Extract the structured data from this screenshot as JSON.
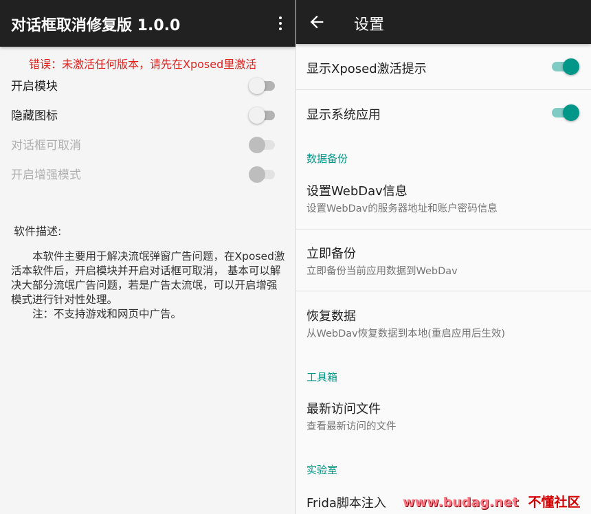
{
  "left": {
    "title": "对话框取消修复版 1.0.0",
    "error": "错误：未激活任何版本，请先在Xposed里激活",
    "switches": [
      {
        "label": "开启模块",
        "state": "off",
        "enabled": true
      },
      {
        "label": "隐藏图标",
        "state": "off",
        "enabled": true
      },
      {
        "label": "对话框可取消",
        "state": "off",
        "enabled": false
      },
      {
        "label": "开启增强模式",
        "state": "off",
        "enabled": false
      }
    ],
    "description_heading": "软件描述:",
    "description": [
      "本软件主要用于解决流氓弹窗广告问题，在Xposed激活本软件后，开启模块并开启对话框可取消， 基本可以解决大部分流氓广告问题，若是广告太流氓，可以开启增强模式进行针对性处理。",
      "注：不支持游戏和网页中广告。"
    ]
  },
  "right": {
    "title": "设置",
    "toggles": [
      {
        "label": "显示Xposed激活提示",
        "state": "on"
      },
      {
        "label": "显示系统应用",
        "state": "on"
      }
    ],
    "sections": [
      {
        "header": "数据备份",
        "items": [
          {
            "title": "设置WebDav信息",
            "subtitle": "设置WebDav的服务器地址和账户密码信息"
          },
          {
            "title": "立即备份",
            "subtitle": "立即备份当前应用数据到WebDav"
          },
          {
            "title": "恢复数据",
            "subtitle": "从WebDav恢复数据到本地(重启应用后生效)"
          }
        ]
      },
      {
        "header": "工具箱",
        "items": [
          {
            "title": "最新访问文件",
            "subtitle": "查看最新访问的文件"
          }
        ]
      },
      {
        "header": "实验室",
        "items": [
          {
            "title": "Frida脚本注入"
          }
        ]
      }
    ]
  },
  "watermark": {
    "url": "www.budag.net",
    "name": "不懂社区"
  },
  "colors": {
    "appbar": "#212121",
    "accent": "#009688",
    "error": "#e0201b"
  },
  "icons": {
    "menu": "more-vert-icon",
    "back": "arrow-back-icon"
  }
}
